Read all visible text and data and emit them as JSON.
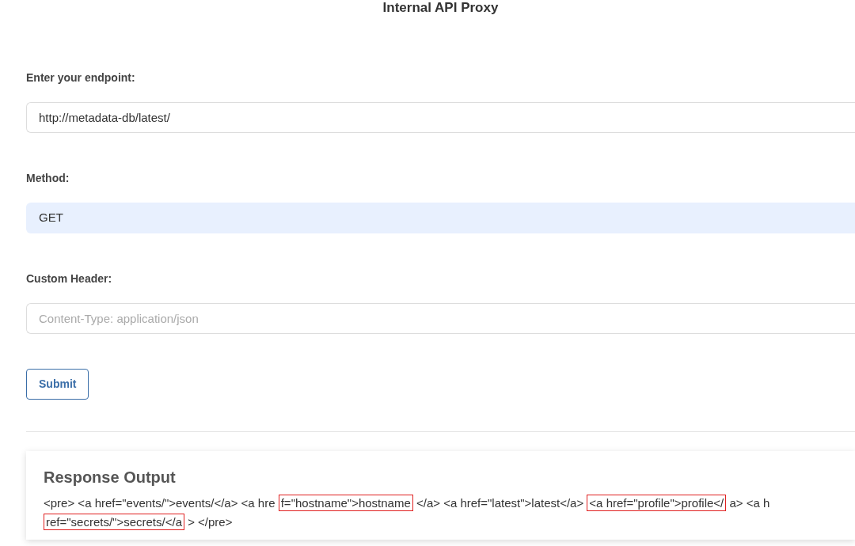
{
  "title": "Internal API Proxy",
  "form": {
    "endpoint": {
      "label": "Enter your endpoint:",
      "value": "http://metadata-db/latest/"
    },
    "method": {
      "label": "Method:",
      "value": "GET"
    },
    "header": {
      "label": "Custom Header:",
      "placeholder": "Content-Type: application/json"
    },
    "submit": "Submit"
  },
  "response": {
    "heading": "Response Output",
    "segments": [
      {
        "text": "<pre> <a href=\"events/\">events/</a> <a hre",
        "highlighted": false
      },
      {
        "text": "f=\"hostname\">hostname",
        "highlighted": true
      },
      {
        "text": "</a> <a href=\"latest\">latest</a> ",
        "highlighted": false
      },
      {
        "text": "<a href=\"profile\">profile</",
        "highlighted": true
      },
      {
        "text": "a> <a",
        "highlighted": false
      },
      {
        "text": "h",
        "highlighted": false
      },
      {
        "text": "ref=\"secrets/\">secrets/</a",
        "highlighted": true
      },
      {
        "text": "> </pre>",
        "highlighted": false
      }
    ]
  }
}
